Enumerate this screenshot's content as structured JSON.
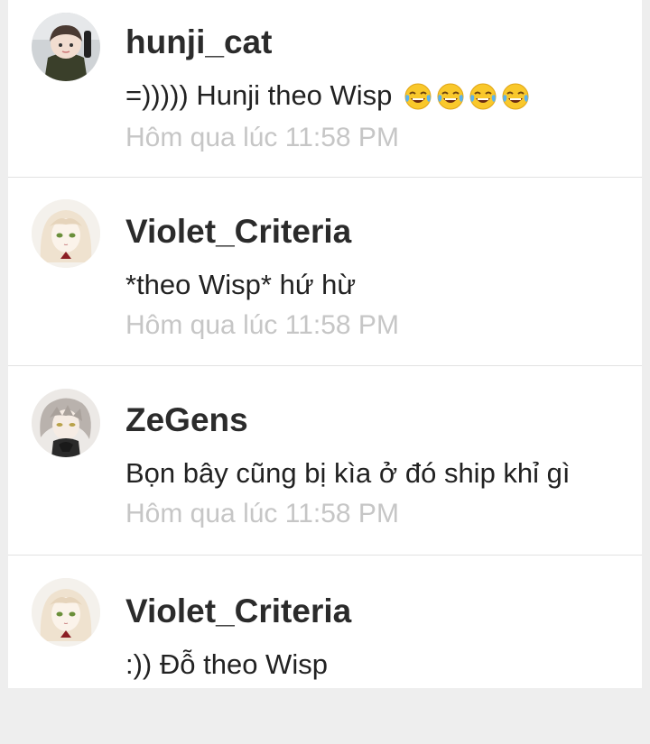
{
  "comments": [
    {
      "username": "hunji_cat",
      "message": "=))))) Hunji theo Wisp",
      "emojis": [
        "face-with-tears-of-joy",
        "face-with-tears-of-joy",
        "face-with-tears-of-joy",
        "face-with-tears-of-joy"
      ],
      "time": "Hôm qua lúc 11:58 PM",
      "avatar": "chibi-doll-avatar"
    },
    {
      "username": "Violet_Criteria",
      "message": "*theo Wisp* hứ hừ",
      "time": "Hôm qua lúc 11:58 PM",
      "avatar": "anime-girl-avatar"
    },
    {
      "username": "ZeGens",
      "message": "Bọn bây cũng bị kìa ở đó ship khỉ gì",
      "time": "Hôm qua lúc 11:58 PM",
      "avatar": "anime-boy-avatar"
    },
    {
      "username": "Violet_Criteria",
      "message": ":)) Đỗ theo Wisp",
      "time": "",
      "avatar": "anime-girl-avatar"
    }
  ],
  "colors": {
    "username": "#2b2b2b",
    "message": "#222222",
    "timestamp": "#c6c6c6",
    "divider": "#e2e2e2"
  }
}
